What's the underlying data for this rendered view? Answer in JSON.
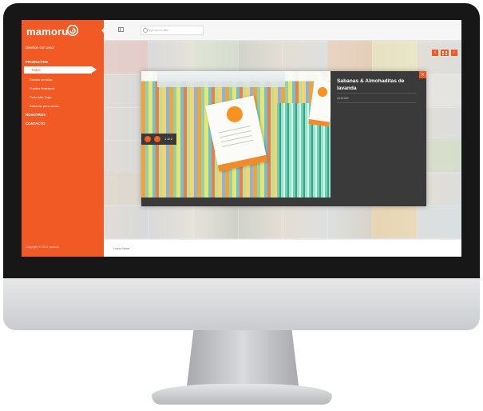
{
  "app": {
    "logo_text": "mamoru",
    "tagline": "Diseños con amor"
  },
  "sidebar": {
    "sections": [
      {
        "label": "PRODUCTOS"
      },
      {
        "label": "NOSOTROS"
      },
      {
        "label": "CONTACTO"
      }
    ],
    "active_item": "Todos",
    "sub_items": [
      {
        "label": "Estolas semillas"
      },
      {
        "label": "Fundas Notebook"
      },
      {
        "label": "Porta Mat Yoga"
      },
      {
        "label": "Sabanas para cunas"
      }
    ],
    "copyright": "Copyright © 2013 mamoru"
  },
  "topbar": {
    "search_placeholder": "Type text to filter"
  },
  "modal": {
    "title": "Sabanas & Almohaditas de lavanda",
    "meta": "AZAHAR",
    "pager_count": "1 of 2"
  },
  "footer": {
    "link": "Leave tweet"
  },
  "colors": {
    "accent": "#f15a24",
    "modal_bg": "#3a3a3a"
  }
}
